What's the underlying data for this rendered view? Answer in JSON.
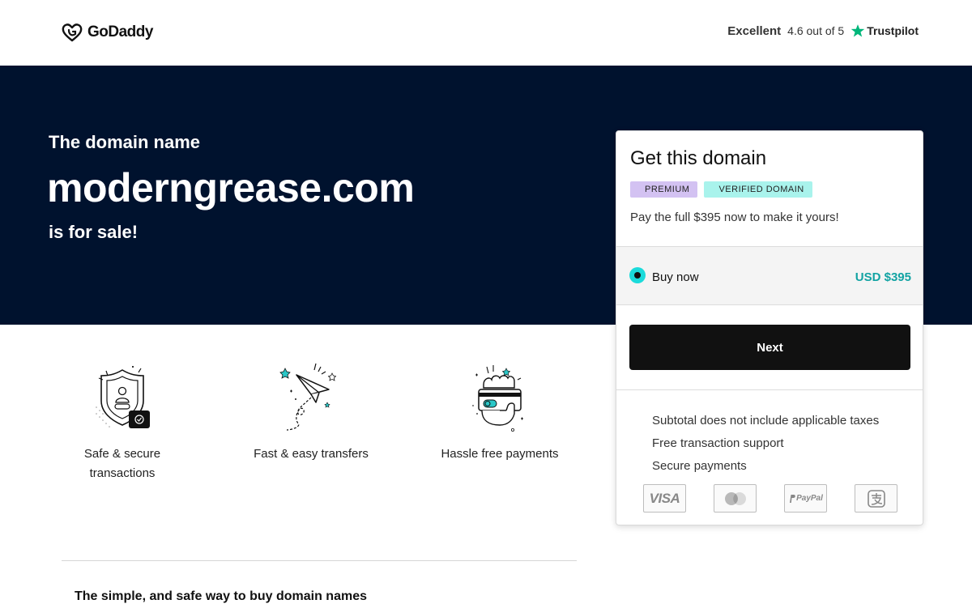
{
  "header": {
    "logo_text": "GoDaddy",
    "trust_rating_label": "Excellent",
    "trust_score": "4.6 out of 5",
    "trust_brand": "Trustpilot"
  },
  "hero": {
    "pre_title": "The domain name",
    "domain": "moderngrease.com",
    "post_title": "is for sale!"
  },
  "features": [
    {
      "icon": "shield-lock-icon",
      "label": "Safe & secure transactions"
    },
    {
      "icon": "paper-plane-icon",
      "label": "Fast & easy transfers"
    },
    {
      "icon": "hand-card-icon",
      "label": "Hassle free payments"
    }
  ],
  "bottom_heading": "The simple, and safe way to buy domain names",
  "card": {
    "title": "Get this domain",
    "badges": [
      "PREMIUM",
      "VERIFIED DOMAIN"
    ],
    "description": "Pay the full $395 now to make it yours!",
    "option": {
      "label": "Buy now",
      "price": "USD $395",
      "selected": true
    },
    "next_label": "Next",
    "info_lines": [
      "Subtotal does not include applicable taxes",
      "Free transaction support",
      "Secure payments"
    ],
    "payment_methods": [
      {
        "icon": "visa-icon",
        "text": "VISA"
      },
      {
        "icon": "mastercard-icon",
        "text": ""
      },
      {
        "icon": "paypal-icon",
        "text": "PayPal"
      },
      {
        "icon": "alipay-icon",
        "text": ""
      }
    ]
  },
  "colors": {
    "hero_bg": "#00122e",
    "accent_teal": "#1bdbdb",
    "price_teal": "#12a3a3",
    "premium_badge": "#d3c2f2",
    "verified_badge": "#a9f3ec",
    "button_bg": "#111111",
    "trustpilot_star": "#00b67a"
  }
}
